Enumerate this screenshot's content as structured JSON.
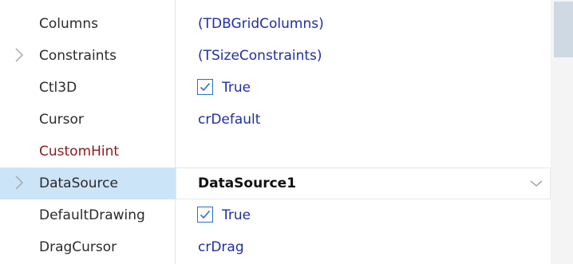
{
  "properties": [
    {
      "name": "Columns",
      "value": "(TDBGridColumns)"
    },
    {
      "name": "Constraints",
      "value": "(TSizeConstraints)",
      "expandable": true
    },
    {
      "name": "Ctl3D",
      "checked": true,
      "check_label": "True"
    },
    {
      "name": "Cursor",
      "value": "crDefault"
    },
    {
      "name": "CustomHint",
      "value": ""
    },
    {
      "name": "DataSource",
      "value": "DataSource1",
      "expandable": true,
      "selected": true
    },
    {
      "name": "DefaultDrawing",
      "checked": true,
      "check_label": "True"
    },
    {
      "name": "DragCursor",
      "value": "crDrag"
    }
  ],
  "colors": {
    "selection": "#cce4f7",
    "value_text": "#1f2fa0",
    "custom_property_text": "#8b1a1a",
    "checkbox_border": "#2a6fc9"
  }
}
